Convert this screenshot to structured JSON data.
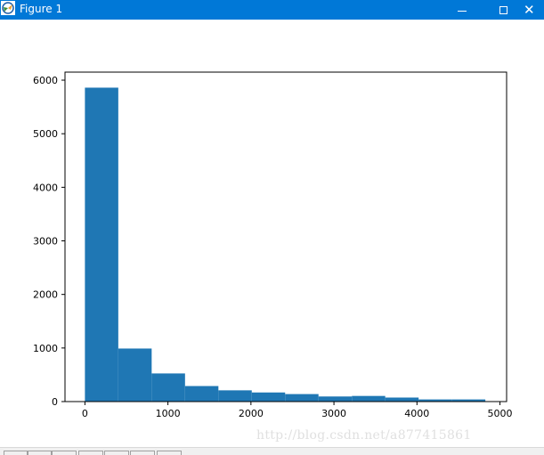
{
  "window": {
    "title": "Figure 1",
    "icon": "matplotlib-figure-icon",
    "controls": {
      "minimize": "minimize-icon",
      "maximize": "maximize-icon",
      "close": "✕"
    }
  },
  "watermark": "http://blog.csdn.net/a877415861",
  "toolbar": {
    "buttons": [
      "home-icon",
      "back-icon",
      "forward-icon",
      "pan-icon",
      "zoom-icon",
      "subplots-icon",
      "save-icon"
    ]
  },
  "colors": {
    "titlebar": "#0078d7",
    "bar": "#1f77b4"
  },
  "chart_data": {
    "type": "bar",
    "title": "",
    "xlabel": "",
    "ylabel": "",
    "xlim": [
      -240,
      5080
    ],
    "ylim": [
      0,
      6150
    ],
    "x_ticks": [
      0,
      1000,
      2000,
      3000,
      4000,
      5000
    ],
    "y_ticks": [
      0,
      1000,
      2000,
      3000,
      4000,
      5000,
      6000
    ],
    "bins": [
      {
        "x0": 0,
        "x1": 402,
        "value": 5860
      },
      {
        "x0": 402,
        "x1": 804,
        "value": 990
      },
      {
        "x0": 804,
        "x1": 1206,
        "value": 525
      },
      {
        "x0": 1206,
        "x1": 1608,
        "value": 290
      },
      {
        "x0": 1608,
        "x1": 2010,
        "value": 210
      },
      {
        "x0": 2010,
        "x1": 2412,
        "value": 170
      },
      {
        "x0": 2412,
        "x1": 2814,
        "value": 140
      },
      {
        "x0": 2814,
        "x1": 3216,
        "value": 95
      },
      {
        "x0": 3216,
        "x1": 3618,
        "value": 105
      },
      {
        "x0": 3618,
        "x1": 4020,
        "value": 75
      },
      {
        "x0": 4020,
        "x1": 4422,
        "value": 40
      },
      {
        "x0": 4422,
        "x1": 4824,
        "value": 40
      }
    ],
    "grid": false,
    "legend": "none"
  }
}
